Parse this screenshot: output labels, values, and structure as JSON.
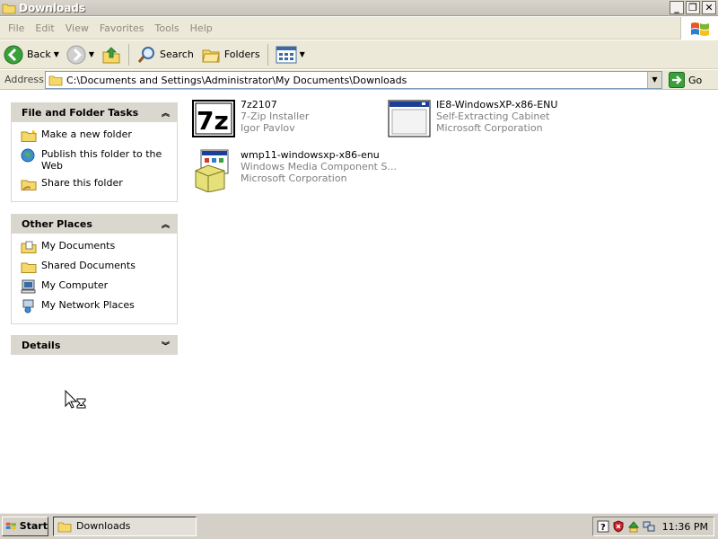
{
  "window": {
    "title": "Downloads"
  },
  "menu": [
    "File",
    "Edit",
    "View",
    "Favorites",
    "Tools",
    "Help"
  ],
  "toolbar": {
    "back_label": "Back",
    "search_label": "Search",
    "folders_label": "Folders"
  },
  "address": {
    "label": "Address",
    "value": "C:\\Documents and Settings\\Administrator\\My Documents\\Downloads",
    "go_label": "Go"
  },
  "tasks_panel": {
    "title": "File and Folder Tasks",
    "items": [
      {
        "label": "Make a new folder",
        "icon": "new-folder-icon"
      },
      {
        "label": "Publish this folder to the Web",
        "icon": "publish-web-icon"
      },
      {
        "label": "Share this folder",
        "icon": "share-folder-icon"
      }
    ]
  },
  "other_places": {
    "title": "Other Places",
    "items": [
      {
        "label": "My Documents",
        "icon": "my-documents-icon"
      },
      {
        "label": "Shared Documents",
        "icon": "shared-documents-icon"
      },
      {
        "label": "My Computer",
        "icon": "my-computer-icon"
      },
      {
        "label": "My Network Places",
        "icon": "network-places-icon"
      }
    ]
  },
  "details": {
    "title": "Details"
  },
  "files": [
    {
      "name": "7z2107",
      "desc": "7-Zip Installer",
      "company": "Igor Pavlov",
      "icon": "7zip-icon"
    },
    {
      "name": "IE8-WindowsXP-x86-ENU",
      "desc": "Self-Extracting Cabinet",
      "company": "Microsoft Corporation",
      "icon": "cabinet-icon"
    },
    {
      "name": "wmp11-windowsxp-x86-enu",
      "desc": "Windows Media Component S...",
      "company": "Microsoft Corporation",
      "icon": "installer-icon"
    }
  ],
  "taskbar": {
    "start_label": "Start",
    "window_label": "Downloads",
    "clock": "11:36 PM"
  },
  "colors": {
    "panel_header": "#dad7ce",
    "address_border": "#7f9db9",
    "menu_text": "#8f8b7e"
  }
}
